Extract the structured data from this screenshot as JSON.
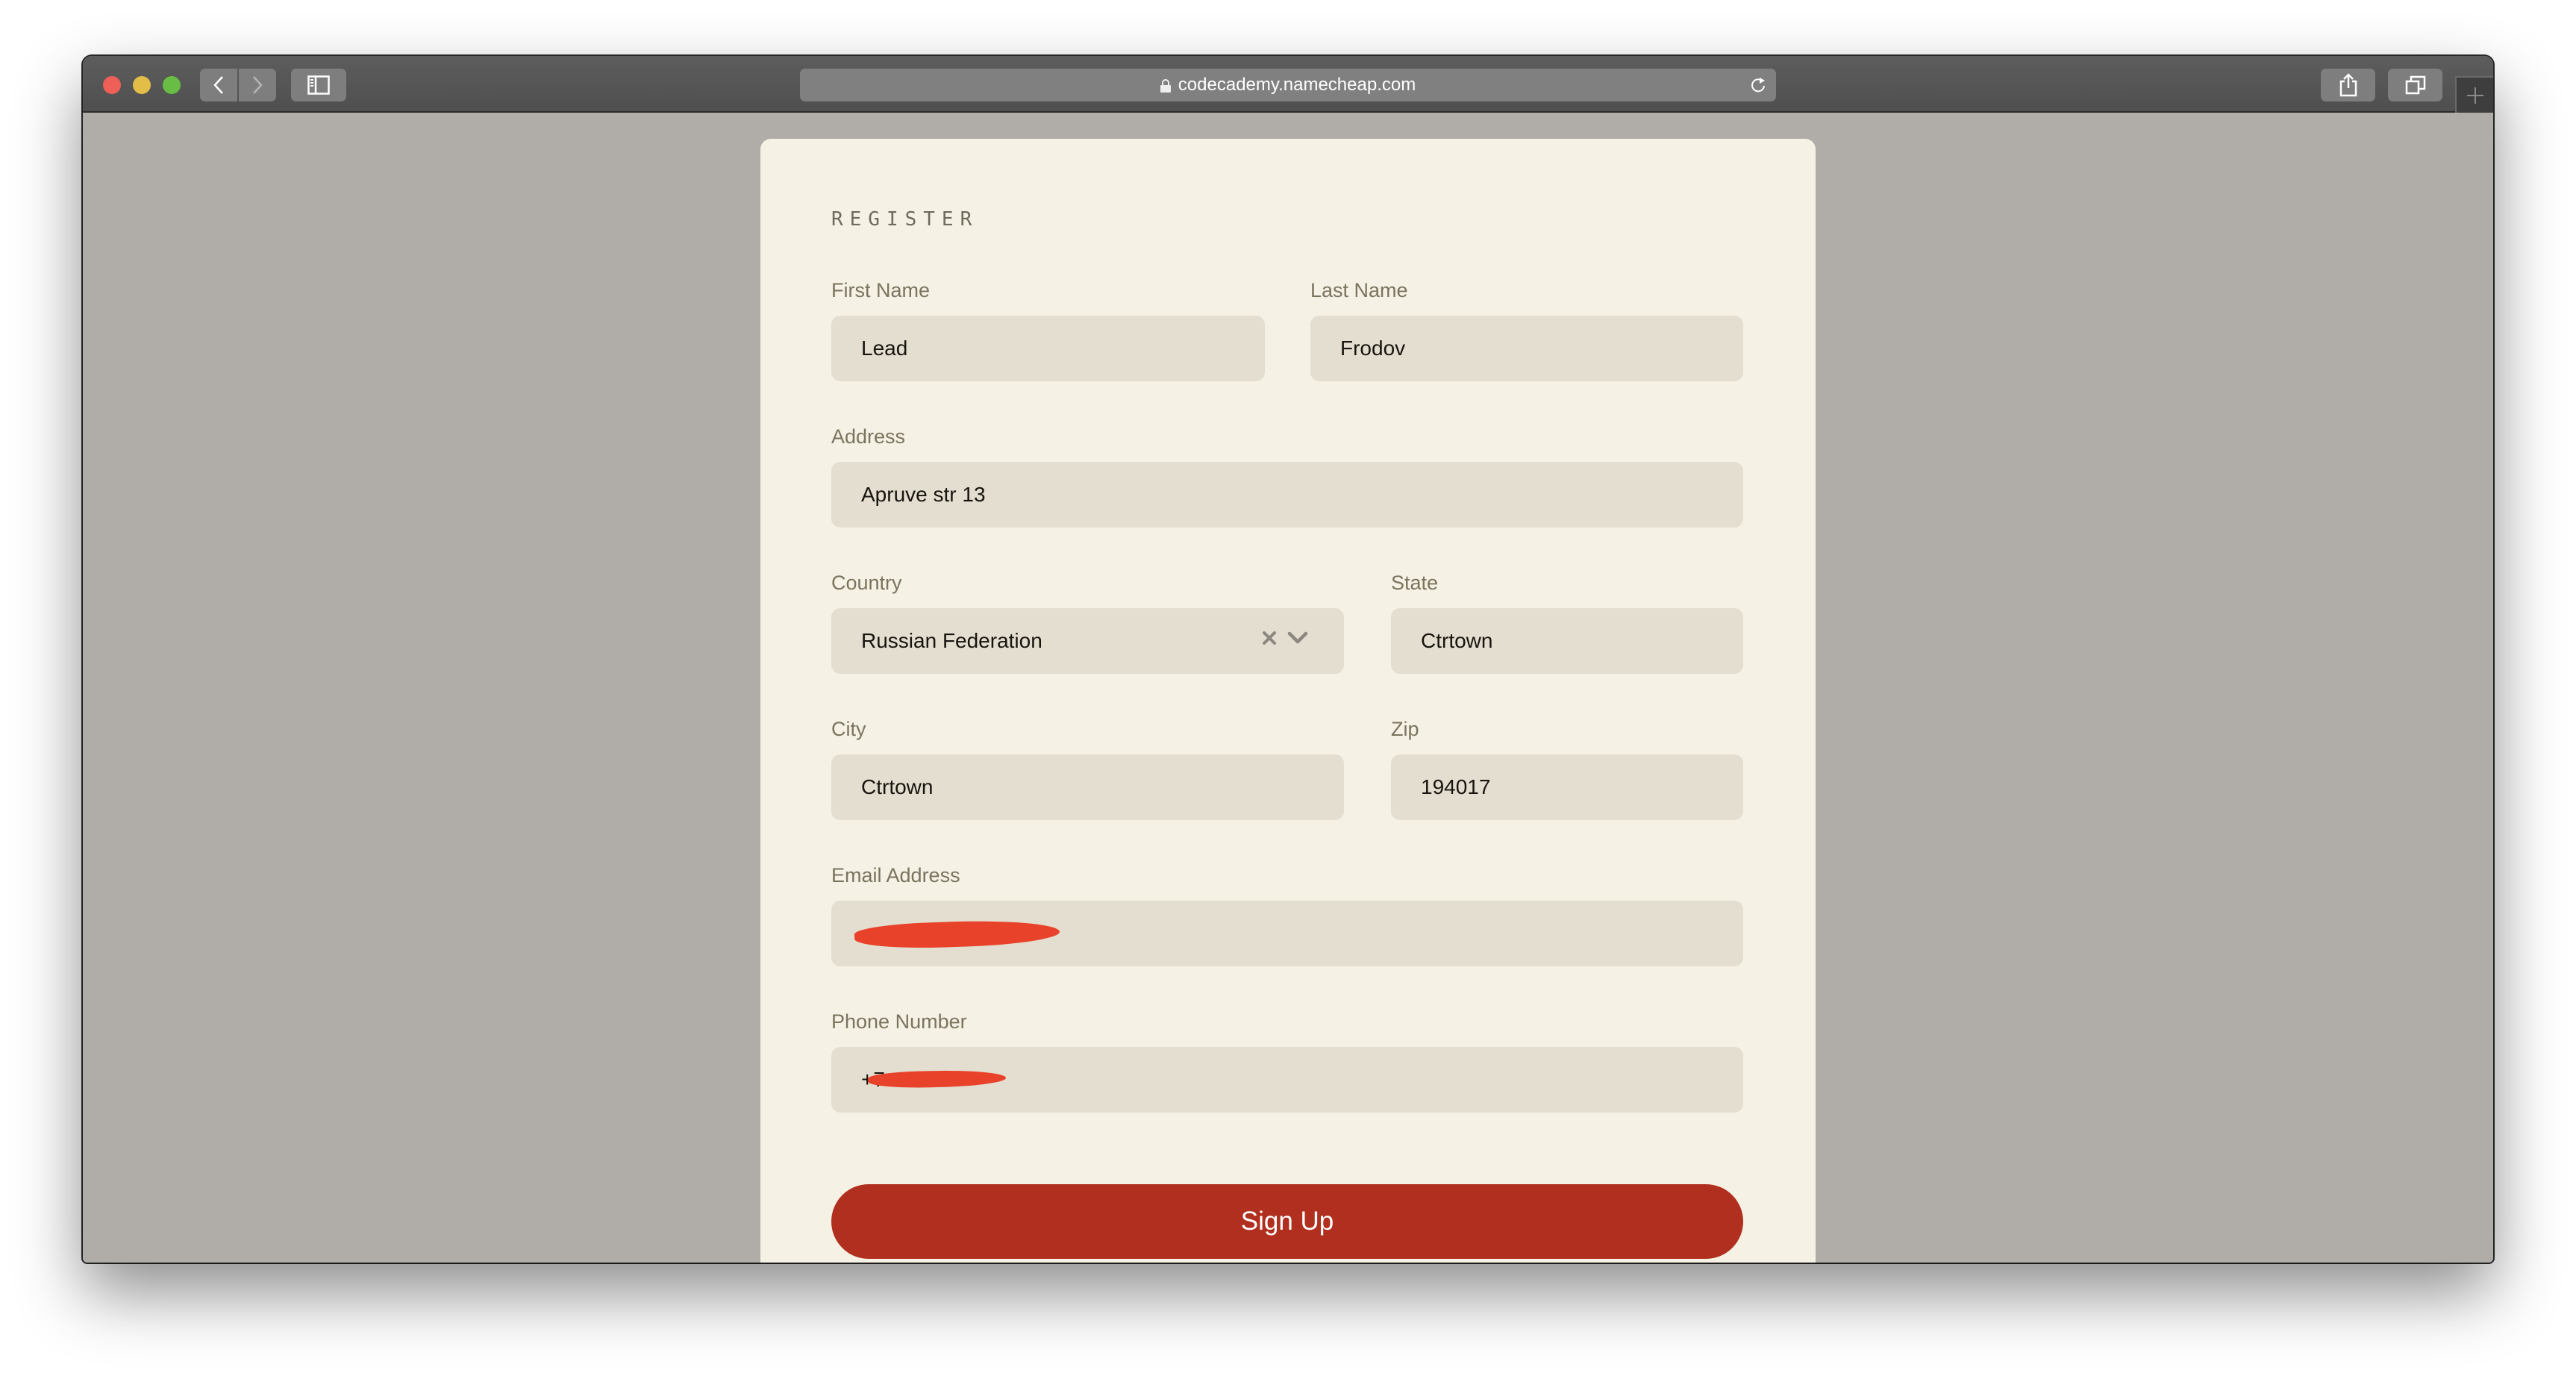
{
  "browser": {
    "url": "codecademy.namecheap.com",
    "buttons": {
      "back": "back",
      "forward": "forward",
      "sidebar": "sidebar",
      "share": "share",
      "tabs": "tabs",
      "new_tab": "new-tab"
    }
  },
  "form": {
    "heading": "REGISTER",
    "fields": {
      "first_name": {
        "label": "First Name",
        "value": "Lead"
      },
      "last_name": {
        "label": "Last Name",
        "value": "Frodov"
      },
      "address": {
        "label": "Address",
        "value": "Apruve str 13"
      },
      "country": {
        "label": "Country",
        "value": "Russian Federation"
      },
      "state": {
        "label": "State",
        "value": "Ctrtown"
      },
      "city": {
        "label": "City",
        "value": "Ctrtown"
      },
      "zip": {
        "label": "Zip",
        "value": "194017"
      },
      "email": {
        "label": "Email Address",
        "value": "[redacted]"
      },
      "phone": {
        "label": "Phone Number",
        "value": "+7"
      }
    },
    "submit_label": "Sign Up"
  },
  "colors": {
    "accent": "#b02f1e",
    "card_bg": "#f5f1e4",
    "input_bg": "#e4ded0",
    "page_bg": "#b0ada8",
    "redaction": "#e8432a"
  }
}
